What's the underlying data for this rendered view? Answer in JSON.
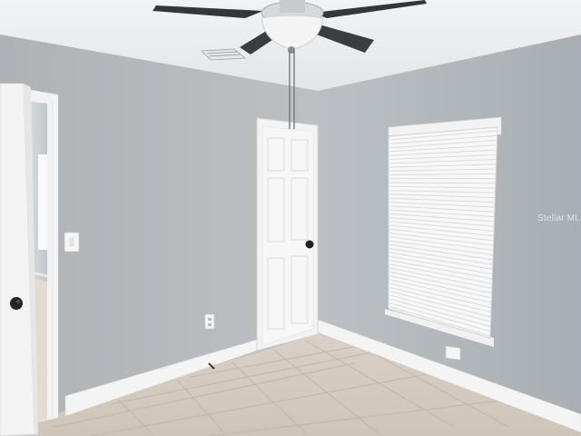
{
  "watermark": {
    "text": "Stellar MLS"
  },
  "colors": {
    "wall_left": "#b6b9bc",
    "wall_right": "#b3b8bd",
    "ceiling": "#eef0f1",
    "trim": "#f3f3f3",
    "floor": "#d8cec3",
    "fan_blade": "#3a3d42"
  },
  "icons": [
    "ceiling-fan-icon",
    "air-vent-icon",
    "light-switch-icon",
    "outlet-icon",
    "door-knob-icon"
  ]
}
